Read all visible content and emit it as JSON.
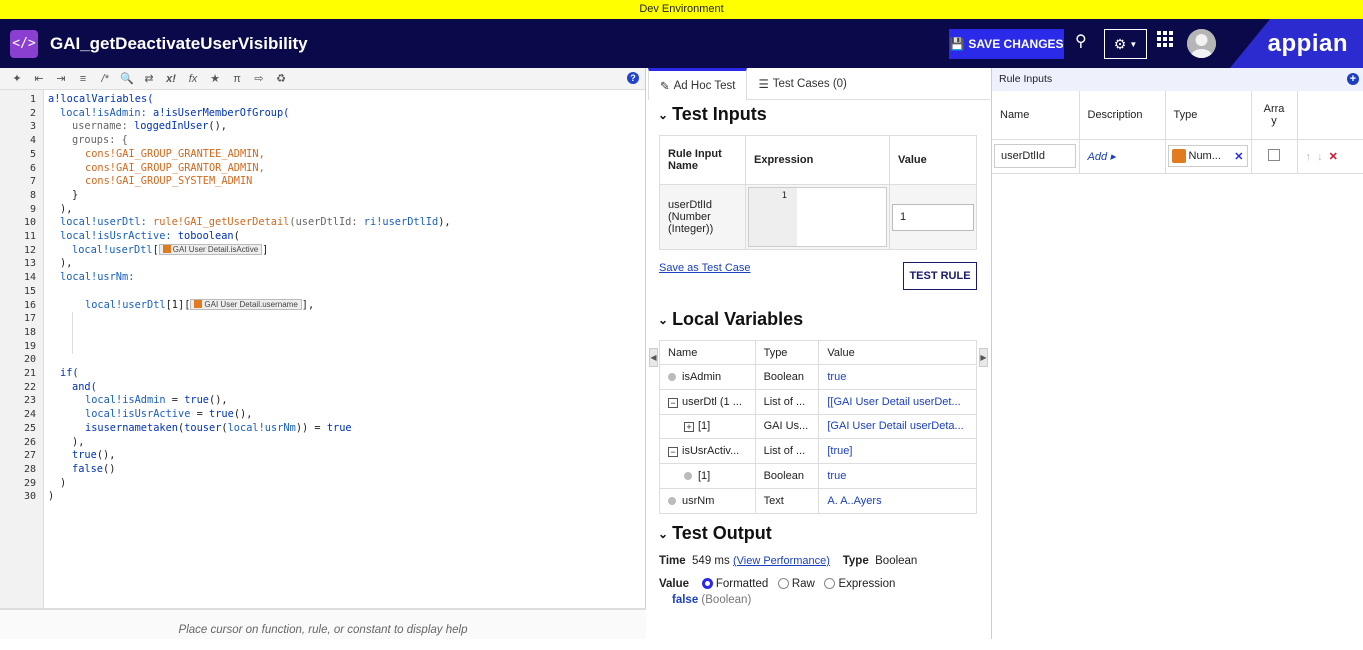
{
  "dev_banner": "Dev Environment",
  "header": {
    "title": "GAI_getDeactivateUserVisibility",
    "save_label": "SAVE CHANGES",
    "logo": "appian"
  },
  "editor": {
    "help_text": "Place cursor on function, rule, or constant to display help",
    "line_numbers": [
      "1",
      "2",
      "3",
      "4",
      "5",
      "6",
      "7",
      "8",
      "9",
      "10",
      "11",
      "12",
      "13",
      "14",
      "15",
      "16",
      "17",
      "18",
      "19",
      "20",
      "21",
      "22",
      "23",
      "24",
      "25",
      "26",
      "27",
      "28",
      "29",
      "30"
    ],
    "code": {
      "l1a": "a!localVariables(",
      "l2a": "local!isAdmin:",
      "l2b": " a!isUserMemberOfGroup(",
      "l3a": "username: ",
      "l3b": "loggedInUser",
      "l3c": "(),",
      "l4a": "groups: {",
      "l5a": "cons!GAI_GROUP_GRANTEE_ADMIN,",
      "l6a": "cons!GAI_GROUP_GRANTOR_ADMIN,",
      "l7a": "cons!GAI_GROUP_SYSTEM_ADMIN",
      "l8a": "}",
      "l9a": "),",
      "l10a": "local!userDtl:",
      "l10b": " rule!GAI_getUserDetail",
      "l10c": "(userDtlId: ",
      "l10d": "ri!userDtlId",
      "l10e": "),",
      "l11a": "local!isUsrActive:",
      "l11b": " toboolean",
      "l11c": "(",
      "l12a": "local!userDtl",
      "l12b": "[",
      "l12chip": "GAI User Detail.isActive",
      "l12c": "]",
      "l13a": "),",
      "l14a": "local!usrNm:",
      "l16a": "local!userDtl",
      "l16b": "[1][",
      "l16chip": "GAI User Detail.username",
      "l16c": "],",
      "l21a": "if(",
      "l22a": "and(",
      "l23a": "local!isAdmin",
      "l23b": " = ",
      "l23c": "true",
      "l23d": "(),",
      "l24a": "local!isUsrActive",
      "l24b": " = ",
      "l24c": "true",
      "l24d": "(),",
      "l25a": "isusernametaken",
      "l25b": "(",
      "l25c": "touser",
      "l25d": "(",
      "l25e": "local!usrNm",
      "l25f": ")) = ",
      "l25g": "true",
      "l26a": "),",
      "l27a": "true",
      "l27b": "(),",
      "l28a": "false",
      "l28b": "()",
      "l29a": ")",
      "l30a": ")"
    }
  },
  "mid": {
    "tabs": [
      {
        "label": "Ad Hoc Test"
      },
      {
        "label": "Test Cases (0)"
      }
    ],
    "test_inputs": {
      "title": "Test Inputs",
      "headers": [
        "Rule Input Name",
        "Expression",
        "Value"
      ],
      "row_name": "userDtlId (Number (Integer))",
      "expr_line": "1",
      "value": "1",
      "save_link": "Save as Test Case",
      "test_button": "TEST RULE"
    },
    "local_vars": {
      "title": "Local Variables",
      "headers": [
        "Name",
        "Type",
        "Value"
      ],
      "rows": [
        {
          "name": "isAdmin",
          "type": "Boolean",
          "value": "true"
        },
        {
          "name": "userDtl (1 ...",
          "type": "List of ...",
          "value": "[[GAI User Detail userDet..."
        },
        {
          "name": "[1]",
          "type": "GAI Us...",
          "value": "[GAI User Detail userDeta..."
        },
        {
          "name": "isUsrActiv...",
          "type": "List of ...",
          "value": "[true]"
        },
        {
          "name": "[1]",
          "type": "Boolean",
          "value": "true"
        },
        {
          "name": "usrNm",
          "type": "Text",
          "value": "A. A..Ayers"
        }
      ]
    },
    "test_output": {
      "title": "Test Output",
      "time_label": "Time",
      "time_value": "549 ms",
      "perf_link": "(View Performance)",
      "type_label": "Type",
      "type_value": "Boolean",
      "value_label": "Value",
      "options": [
        "Formatted",
        "Raw",
        "Expression"
      ],
      "result": "false",
      "result_type": "(Boolean)"
    }
  },
  "rule_inputs": {
    "title": "Rule Inputs",
    "headers": [
      "Name",
      "Description",
      "Type",
      "Arra y"
    ],
    "row": {
      "name": "userDtlId",
      "description": "Add",
      "type": "Num..."
    }
  }
}
